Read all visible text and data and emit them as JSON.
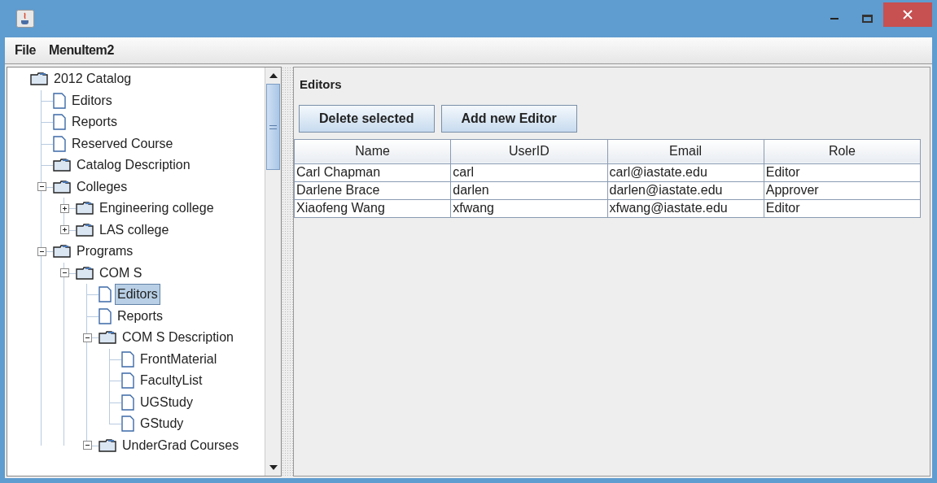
{
  "menu": [
    "File",
    "MenuItem2"
  ],
  "tree": [
    {
      "label": "2012 Catalog",
      "kind": "folder",
      "selected": false,
      "children": [
        {
          "label": "Editors",
          "kind": "file",
          "selected": false
        },
        {
          "label": "Reports",
          "kind": "file",
          "selected": false
        },
        {
          "label": "Reserved Course",
          "kind": "file",
          "selected": false
        },
        {
          "label": "Catalog Description",
          "kind": "folder",
          "selected": false
        },
        {
          "label": "Colleges",
          "kind": "folder",
          "selected": false,
          "expanded": true,
          "children": [
            {
              "label": "Engineering college",
              "kind": "folder",
              "selected": false,
              "expanded": false
            },
            {
              "label": "LAS college",
              "kind": "folder",
              "selected": false,
              "expanded": false
            }
          ]
        },
        {
          "label": "Programs",
          "kind": "folder",
          "selected": false,
          "expanded": true,
          "children": [
            {
              "label": "COM S",
              "kind": "folder",
              "selected": false,
              "expanded": true,
              "children": [
                {
                  "label": "Editors",
                  "kind": "file",
                  "selected": true
                },
                {
                  "label": "Reports",
                  "kind": "file",
                  "selected": false
                },
                {
                  "label": "COM S Description",
                  "kind": "folder",
                  "selected": false,
                  "expanded": true,
                  "children": [
                    {
                      "label": "FrontMaterial",
                      "kind": "file",
                      "selected": false
                    },
                    {
                      "label": "FacultyList",
                      "kind": "file",
                      "selected": false
                    },
                    {
                      "label": "UGStudy",
                      "kind": "file",
                      "selected": false
                    },
                    {
                      "label": "GStudy",
                      "kind": "file",
                      "selected": false
                    }
                  ]
                },
                {
                  "label": "UnderGrad Courses",
                  "kind": "folder",
                  "selected": false,
                  "expanded": true
                }
              ]
            }
          ]
        }
      ]
    }
  ],
  "panel": {
    "title": "Editors",
    "buttons": [
      "Delete selected",
      "Add new Editor"
    ],
    "table": {
      "columns": [
        "Name",
        "UserID",
        "Email",
        "Role"
      ],
      "rows": [
        [
          "Carl Chapman",
          "carl",
          "carl@iastate.edu",
          "Editor"
        ],
        [
          "Darlene Brace",
          "darlen",
          "darlen@iastate.edu",
          "Approver"
        ],
        [
          "Xiaofeng Wang",
          "xfwang",
          "xfwang@iastate.edu",
          "Editor"
        ]
      ]
    }
  }
}
